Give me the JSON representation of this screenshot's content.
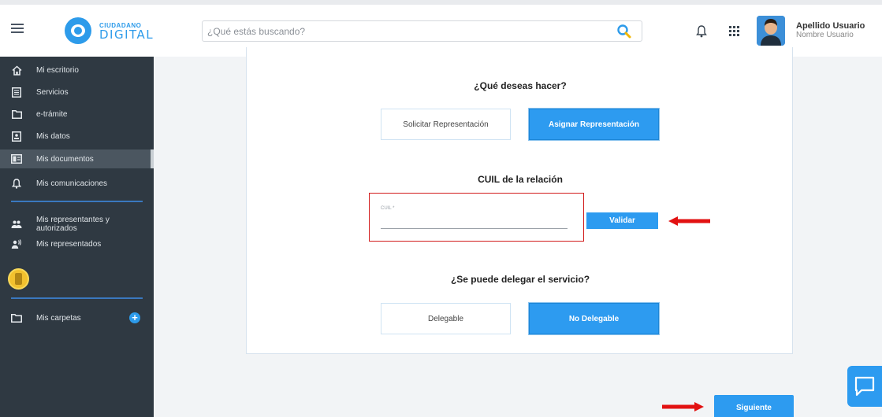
{
  "header": {
    "logo_small": "CIUDADANO",
    "logo_big": "DIGITAL",
    "search_placeholder": "¿Qué estás buscando?",
    "user_name": "Apellido Usuario",
    "user_sub": "Nombre Usuario"
  },
  "sidebar": {
    "items": [
      {
        "label": "Mi escritorio",
        "icon": "home-icon"
      },
      {
        "label": "Servicios",
        "icon": "services-icon"
      },
      {
        "label": "e-trámite",
        "icon": "folder-outline-icon"
      },
      {
        "label": "Mis datos",
        "icon": "id-card-icon"
      },
      {
        "label": "Mis documentos",
        "icon": "documents-icon",
        "active": true
      },
      {
        "label": "Mis comunicaciones",
        "icon": "bell-icon"
      },
      {
        "label": "Mis representantes y autorizados",
        "icon": "people-icon"
      },
      {
        "label": "Mis representados",
        "icon": "person-voice-icon"
      },
      {
        "label": "Mis carpetas",
        "icon": "folder-icon"
      }
    ],
    "rep_line1": "Mis representantes y",
    "rep_line2": "autorizados"
  },
  "main": {
    "question1": "¿Qué deseas hacer?",
    "btn_solicitar": "Solicitar Representación",
    "btn_asignar": "Asignar Representación",
    "cuil_title": "CUIL de la relación",
    "cuil_label": "CUIL *",
    "cuil_value": "",
    "validar": "Validar",
    "question2": "¿Se puede delegar el servicio?",
    "btn_delegable": "Delegable",
    "btn_no_delegable": "No Delegable",
    "siguiente": "Siguiente"
  },
  "colors": {
    "accent": "#2d9bf0",
    "sidebar_bg": "#2f3942",
    "highlight_red": "#d21b1b"
  }
}
